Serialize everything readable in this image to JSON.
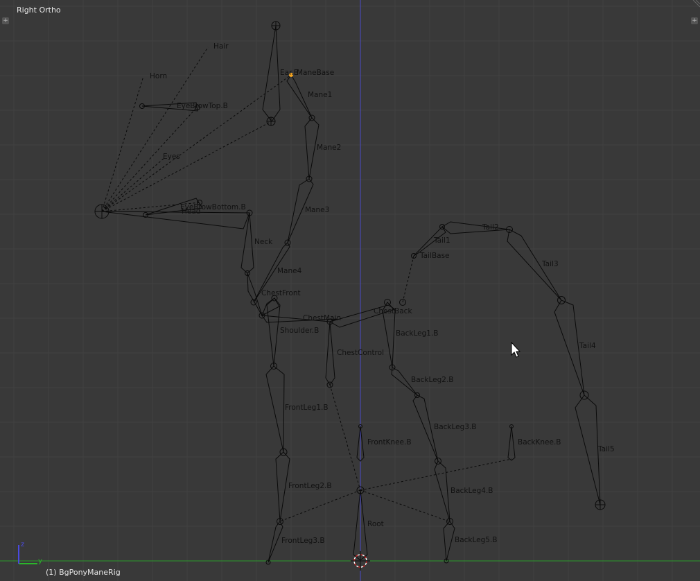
{
  "viewport": {
    "title": "Right Ortho",
    "object_name": "(1) BgPonyManeRig",
    "axis_labels": {
      "z": "z",
      "y": "y"
    }
  },
  "bone_labels": {
    "hair": "Hair",
    "horn": "Horn",
    "ear": "Ear.B",
    "mane_base": "ManeBase",
    "mane1": "Mane1",
    "eyebrow_top": "EyeBrowTop.B",
    "mane2": "Mane2",
    "eyes": "Eyes",
    "eyebrow_bottom": "EyeBrowBottom.B",
    "head": "Head",
    "mane3": "Mane3",
    "neck": "Neck",
    "tail2": "Tail2",
    "tail1": "Tail1",
    "tail_base": "TailBase",
    "tail3": "Tail3",
    "mane4": "Mane4",
    "chest_front": "ChestFront",
    "chest_main": "ChestMain",
    "chest_back": "ChestBack",
    "shoulder": "Shoulder.B",
    "back_leg1": "BackLeg1.B",
    "chest_control": "ChestControl",
    "tail4": "Tail4",
    "back_leg2": "BackLeg2.B",
    "front_leg1": "FrontLeg1.B",
    "back_leg3": "BackLeg3.B",
    "front_knee": "FrontKnee.B",
    "back_knee": "BackKnee.B",
    "tail5": "Tail5",
    "front_leg2": "FrontLeg2.B",
    "back_leg4": "BackLeg4.B",
    "root": "Root",
    "front_leg3": "FrontLeg3.B",
    "back_leg5": "BackLeg5.B"
  },
  "colors": {
    "background": "#393939",
    "grid": "#414141",
    "y_axis_line": "#2a9a2a",
    "z_axis_line": "#4a4ac8",
    "selected_joint": "#f5a623",
    "cursor_red": "#d02020"
  }
}
